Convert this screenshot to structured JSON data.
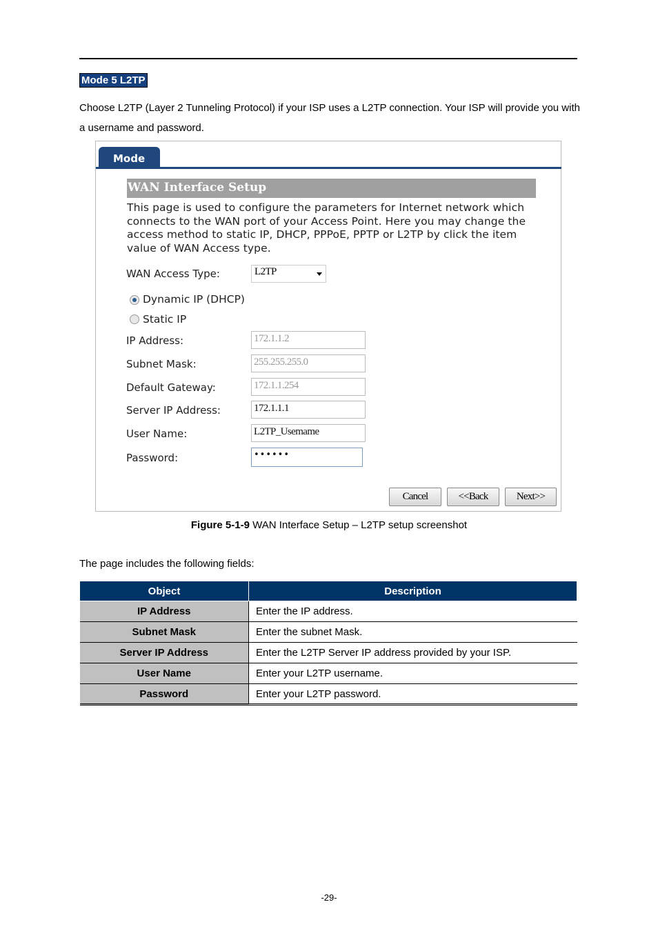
{
  "section_heading": "Mode 5 L2TP",
  "intro_paragraph": "Choose L2TP (Layer 2 Tunneling Protocol) if your ISP uses a L2TP connection. Your ISP will provide you with a username and password.",
  "screenshot": {
    "tab": "Mode",
    "header": "WAN Interface Setup",
    "description": "This page is used to configure the parameters for Internet network which connects to the WAN port of your Access Point. Here you may change the access method to static IP, DHCP, PPPoE, PPTP or L2TP by click the item value of WAN Access type.",
    "wan_access_type_label": "WAN Access Type:",
    "wan_access_type_value": "L2TP",
    "radio_dynamic": "Dynamic IP (DHCP)",
    "radio_static": "Static IP",
    "selected_radio": "Dynamic IP (DHCP)",
    "fields": [
      {
        "label": "IP Address:",
        "value": "172.1.1.2",
        "disabled": true
      },
      {
        "label": "Subnet Mask:",
        "value": "255.255.255.0",
        "disabled": true
      },
      {
        "label": "Default Gateway:",
        "value": "172.1.1.254",
        "disabled": true
      },
      {
        "label": "Server IP Address:",
        "value": "172.1.1.1",
        "disabled": false
      },
      {
        "label": "User Name:",
        "value": "L2TP_Usemame",
        "disabled": false
      },
      {
        "label": "Password:",
        "value": "••••••",
        "disabled": false
      }
    ],
    "buttons": {
      "cancel": "Cancel",
      "back": "<<Back",
      "next": "Next>>"
    },
    "colors": {
      "tab": "#1f477d",
      "header_bar": "#a0a0a0"
    }
  },
  "caption": {
    "label": "Figure 5-1-9",
    "text": " WAN Interface Setup – L2TP setup screenshot"
  },
  "fields_intro": "The page includes the following fields:",
  "table": {
    "headers": [
      "Object",
      "Description"
    ],
    "rows": [
      [
        "IP Address",
        "Enter the IP address."
      ],
      [
        "Subnet Mask",
        "Enter the subnet Mask."
      ],
      [
        "Server IP Address",
        "Enter the L2TP Server IP address provided by your ISP."
      ],
      [
        "User Name",
        "Enter your L2TP username."
      ],
      [
        "Password",
        "Enter your L2TP password."
      ]
    ],
    "colors": {
      "header_bg": "#003366",
      "object_bg": "#c0c0c0"
    }
  },
  "page_number": "-29-"
}
